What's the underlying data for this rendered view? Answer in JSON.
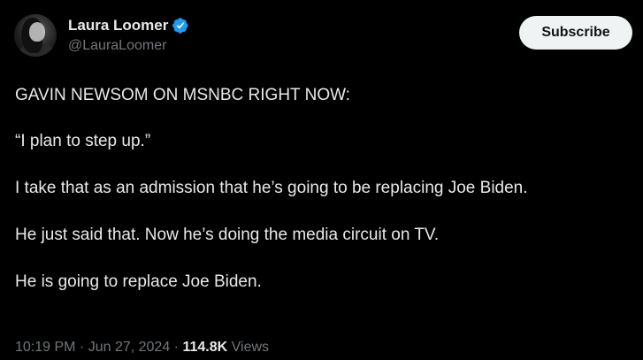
{
  "author": {
    "display_name": "Laura Loomer",
    "handle": "@LauraLoomer",
    "verified_color": "#1d9bf0"
  },
  "actions": {
    "subscribe_label": "Subscribe"
  },
  "tweet": {
    "paragraphs": [
      "GAVIN NEWSOM ON MSNBC RIGHT NOW:",
      "“I plan to step up.”",
      "I take that as an admission that he’s going to be replacing Joe Biden.",
      "He just said that. Now he’s doing the media circuit on TV.",
      "He is going to replace Joe Biden."
    ]
  },
  "meta": {
    "time": "10:19 PM",
    "separator": " · ",
    "date": "Jun 27, 2024",
    "views_count": "114.8K",
    "views_label": "Views"
  },
  "colors": {
    "background": "#000000",
    "text_primary": "#e7e9ea",
    "text_secondary": "#71767b",
    "button_bg": "#eff3f4"
  }
}
